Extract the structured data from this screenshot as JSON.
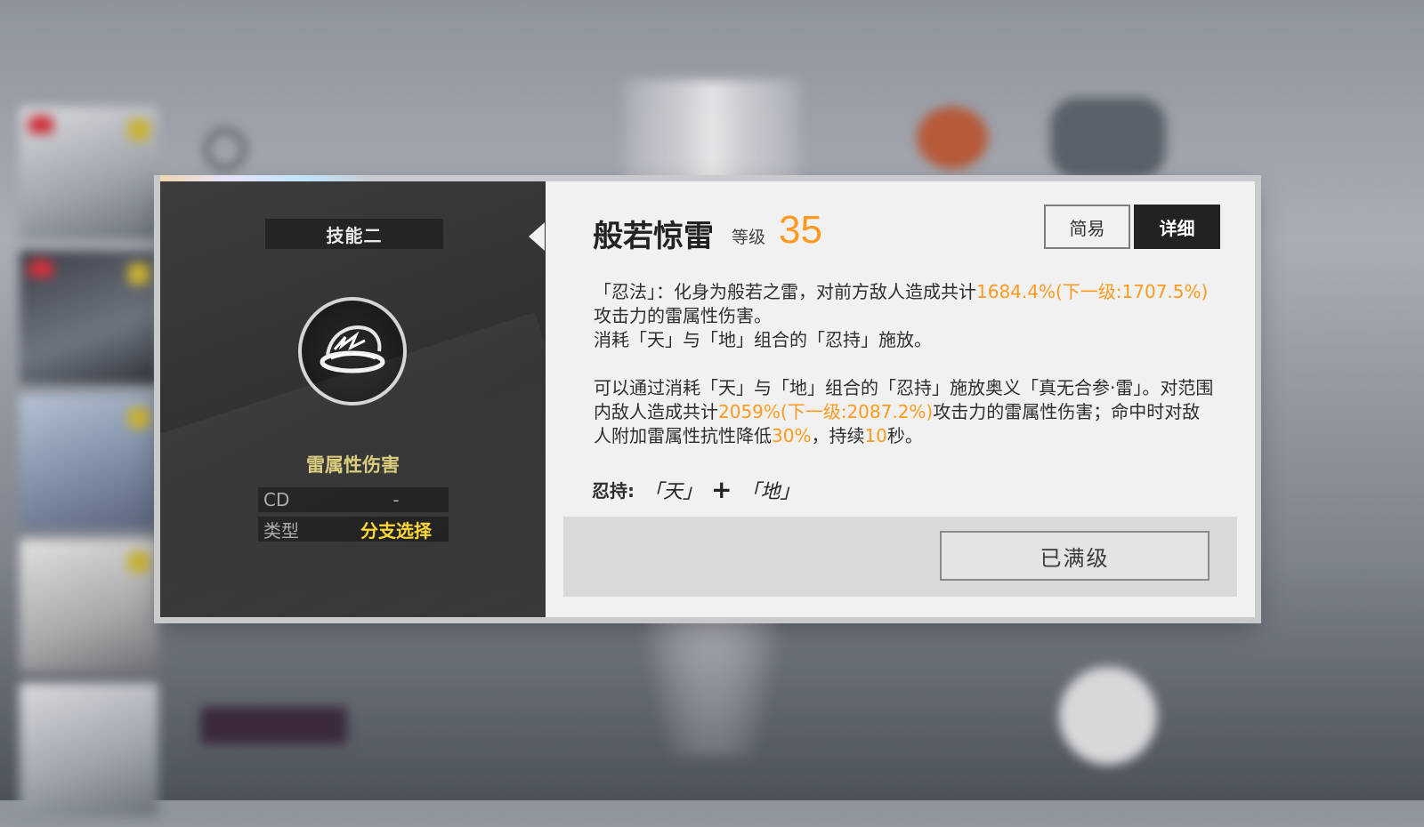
{
  "skill_panel": {
    "slot_label": "技能二",
    "icon": "lightning-orb-icon",
    "damage_type": "雷属性伤害",
    "stats": [
      {
        "key": "CD",
        "value": "-"
      },
      {
        "key": "类型",
        "value": "分支选择"
      }
    ]
  },
  "detail_panel": {
    "skill_name": "般若惊雷",
    "level_label": "等级",
    "level_value": "35",
    "tabs": {
      "simple": "简易",
      "detail": "详细"
    },
    "active_tab": "detail",
    "description": {
      "line1_prefix": "「忍法」：化身为般若之雷，对前方敌人造成共计",
      "line1_highlight": "1684.4%(下一级:1707.5%)",
      "line1_suffix": "攻击力的雷属性伤害。",
      "line2": "消耗「天」与「地」组合的「忍持」施放。",
      "line3_prefix": "可以通过消耗「天」与「地」组合的「忍持」施放奥义「真无合参·雷」。对范围内敌人造成共计",
      "line3_highlight": "2059%(下一级:2087.2%)",
      "line3_mid": "攻击力的雷属性伤害；命中时对敌人附加雷属性抗性降低",
      "line3_pct": "30%",
      "line3_mid2": "，持续",
      "line3_duration": "10",
      "line3_suffix": "秒。"
    },
    "ninja_hold": {
      "label": "忍持:",
      "seal_1": "「天」",
      "plus": "+",
      "seal_2": "「地」"
    },
    "max_level_button": "已满级"
  },
  "colors": {
    "accent_orange": "#ff9a1e",
    "accent_yellow": "#ffd633",
    "damage_type_color": "#d9cc7a"
  }
}
